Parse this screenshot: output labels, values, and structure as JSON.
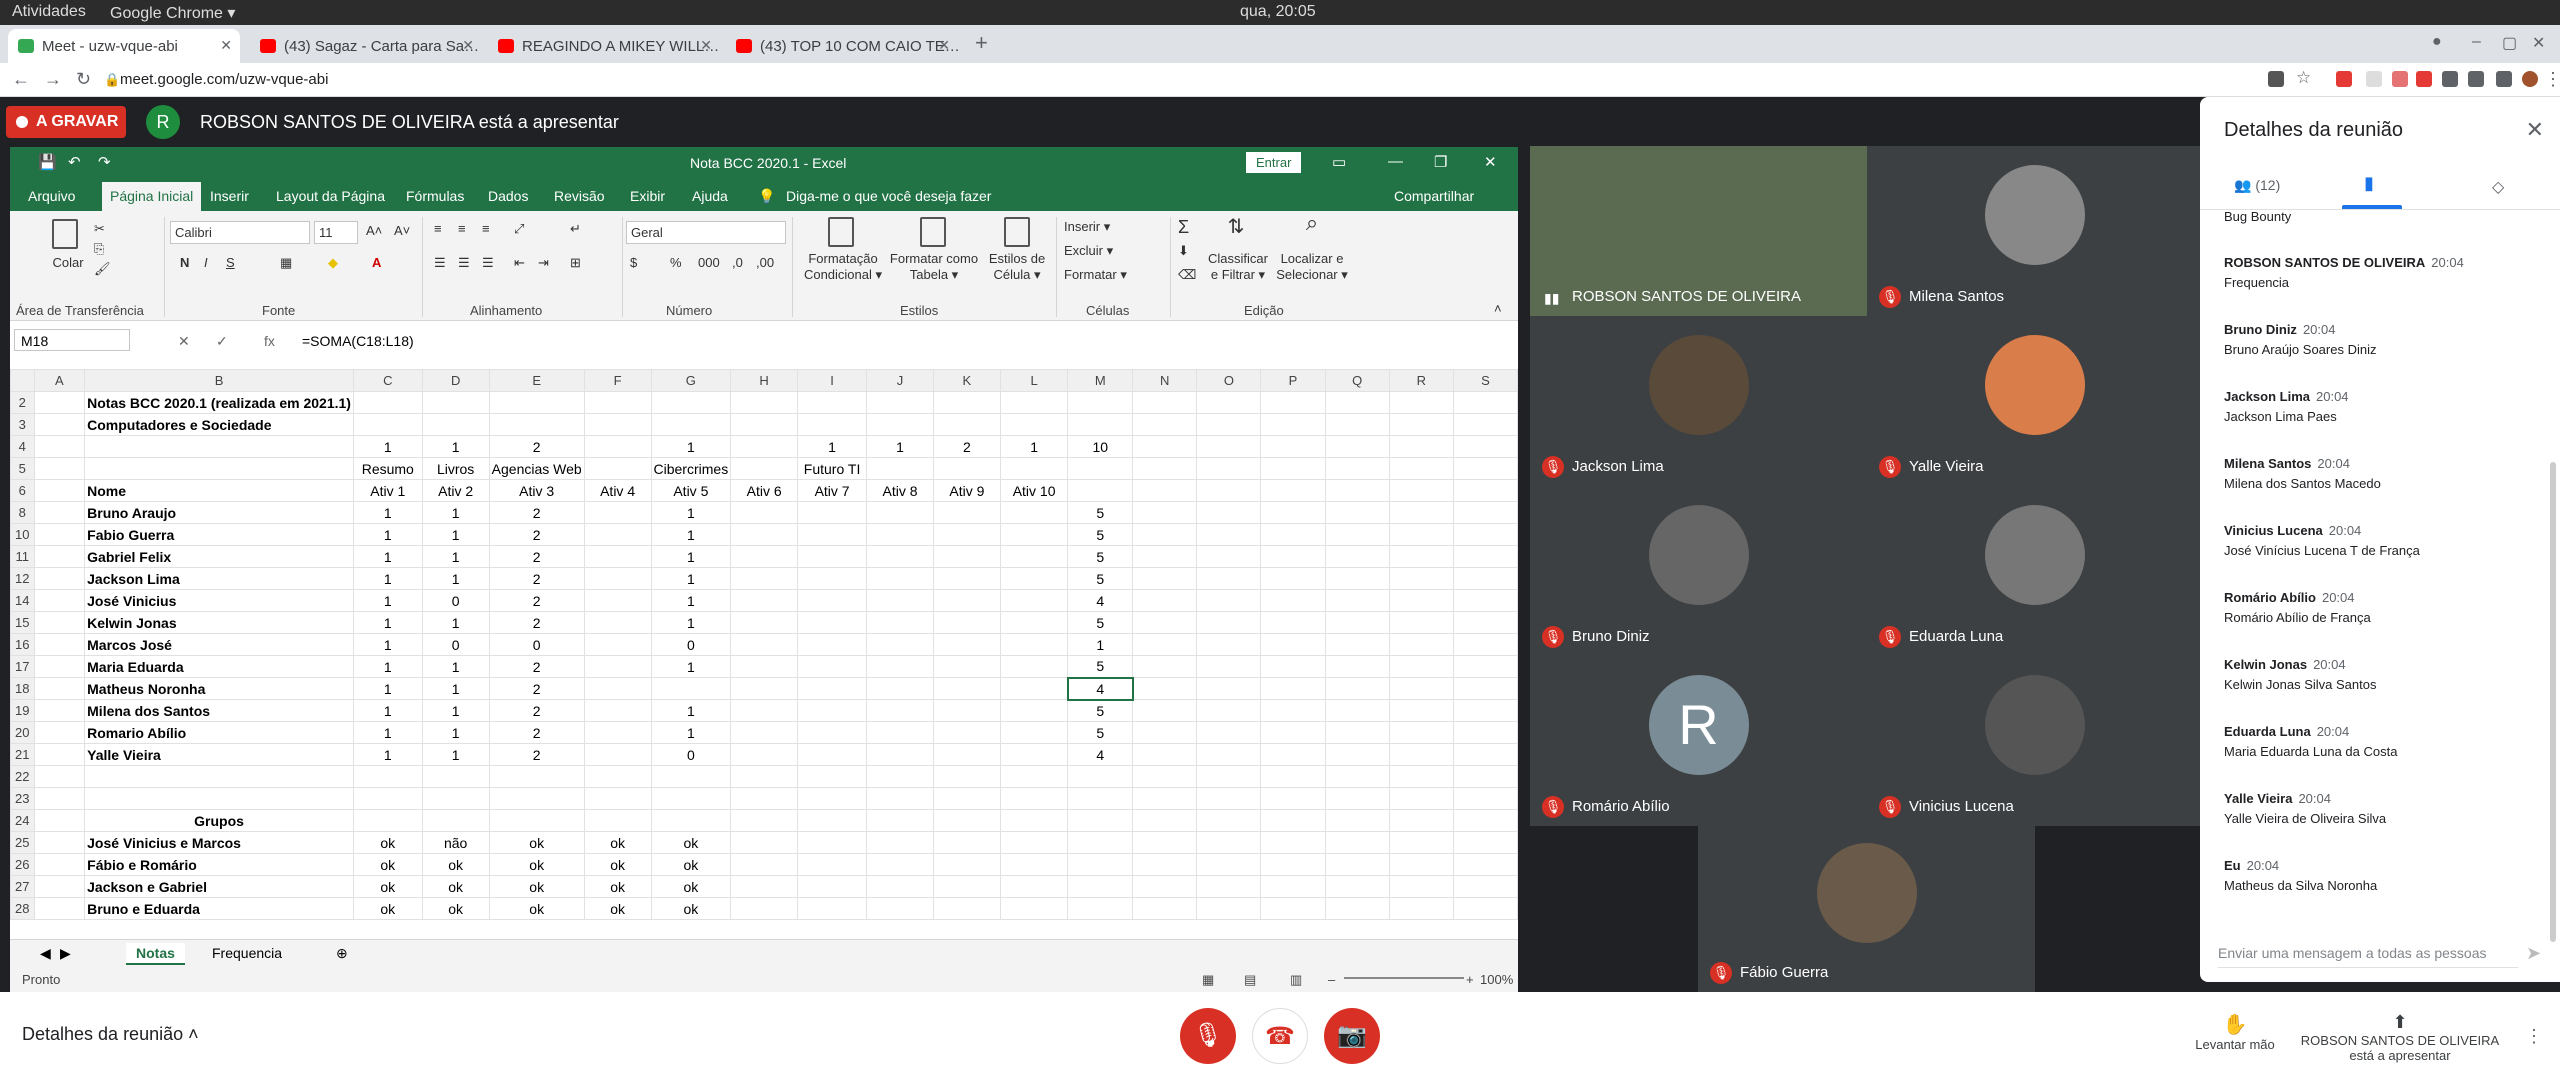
{
  "system": {
    "activities": "Atividades",
    "app": "Google Chrome ▾",
    "clock": "qua, 20:05"
  },
  "tabs": [
    {
      "title": "Meet - uzw-vque-abi",
      "color": "#34a853"
    },
    {
      "title": "(43) Sagaz - Carta para Sa…",
      "color": "#ff0000"
    },
    {
      "title": "REAGINDO A MIKEY WILL…",
      "color": "#ff0000"
    },
    {
      "title": "(43) TOP 10 COM CAIO TE…",
      "color": "#ff0000"
    }
  ],
  "address": {
    "url": "meet.google.com/uzw-vque-abi"
  },
  "meet": {
    "recording": "A GRAVAR",
    "presenter_initial": "R",
    "presenting_text": "ROBSON SANTOS DE OLIVEIRA está a apresentar"
  },
  "excel": {
    "title": "Nota BCC 2020.1  -  Excel",
    "enter": "Entrar",
    "menu": [
      "Arquivo",
      "Página Inicial",
      "Inserir",
      "Layout da Página",
      "Fórmulas",
      "Dados",
      "Revisão",
      "Exibir",
      "Ajuda",
      "Diga-me o que você deseja fazer",
      "Compartilhar"
    ],
    "ribbon": {
      "paste": "Colar",
      "font": "Calibri",
      "size": "11",
      "format": "Geral",
      "groups": [
        "Área de Transferência",
        "Fonte",
        "Alinhamento",
        "Número",
        "Estilos",
        "Células",
        "Edição"
      ],
      "styles": [
        "Formatação Condicional ▾",
        "Formatar como Tabela ▾",
        "Estilos de Célula ▾"
      ],
      "cells": [
        "Inserir ▾",
        "Excluir ▾",
        "Formatar ▾"
      ],
      "edit": [
        "Classificar e Filtrar ▾",
        "Localizar e Selecionar ▾"
      ]
    },
    "namebox": "M18",
    "fx": "fx",
    "formula": "=SOMA(C18:L18)",
    "cols": [
      "A",
      "B",
      "C",
      "D",
      "E",
      "F",
      "G",
      "H",
      "I",
      "J",
      "K",
      "L",
      "M",
      "N",
      "O",
      "P",
      "Q",
      "R",
      "S"
    ],
    "rows": [
      {
        "n": "2",
        "b": "Notas BCC 2020.1 (realizada em 2021.1)",
        "c": []
      },
      {
        "n": "3",
        "b": "Computadores e Sociedade",
        "c": []
      },
      {
        "n": "4",
        "b": "",
        "c": [
          "1",
          "1",
          "2",
          "",
          "1",
          "",
          "1",
          "1",
          "2",
          "1",
          "10"
        ]
      },
      {
        "n": "5",
        "b": "",
        "c": [
          "Resumo",
          "Livros",
          "Agencias Web",
          "",
          "Cibercrimes",
          "",
          "Futuro TI",
          "",
          "",
          "",
          ""
        ]
      },
      {
        "n": "6",
        "b": "Nome",
        "c": [
          "Ativ 1",
          "Ativ 2",
          "Ativ 3",
          "Ativ 4",
          "Ativ 5",
          "Ativ 6",
          "Ativ 7",
          "Ativ 8",
          "Ativ 9",
          "Ativ 10",
          ""
        ]
      },
      {
        "n": "8",
        "b": "Bruno Araujo",
        "c": [
          "1",
          "1",
          "2",
          "",
          "1",
          "",
          "",
          "",
          "",
          "",
          "5"
        ]
      },
      {
        "n": "10",
        "b": "Fabio Guerra",
        "c": [
          "1",
          "1",
          "2",
          "",
          "1",
          "",
          "",
          "",
          "",
          "",
          "5"
        ]
      },
      {
        "n": "11",
        "b": "Gabriel Felix",
        "c": [
          "1",
          "1",
          "2",
          "",
          "1",
          "",
          "",
          "",
          "",
          "",
          "5"
        ]
      },
      {
        "n": "12",
        "b": "Jackson Lima",
        "c": [
          "1",
          "1",
          "2",
          "",
          "1",
          "",
          "",
          "",
          "",
          "",
          "5"
        ]
      },
      {
        "n": "14",
        "b": "José Vinicius",
        "c": [
          "1",
          "0",
          "2",
          "",
          "1",
          "",
          "",
          "",
          "",
          "",
          "4"
        ]
      },
      {
        "n": "15",
        "b": "Kelwin Jonas",
        "c": [
          "1",
          "1",
          "2",
          "",
          "1",
          "",
          "",
          "",
          "",
          "",
          "5"
        ]
      },
      {
        "n": "16",
        "b": "Marcos José",
        "c": [
          "1",
          "0",
          "0",
          "",
          "0",
          "",
          "",
          "",
          "",
          "",
          "1"
        ]
      },
      {
        "n": "17",
        "b": "Maria Eduarda",
        "c": [
          "1",
          "1",
          "2",
          "",
          "1",
          "",
          "",
          "",
          "",
          "",
          "5"
        ]
      },
      {
        "n": "18",
        "b": "Matheus Noronha",
        "c": [
          "1",
          "1",
          "2",
          "",
          "",
          "",
          "",
          "",
          "",
          "",
          "4"
        ]
      },
      {
        "n": "19",
        "b": "Milena dos Santos",
        "c": [
          "1",
          "1",
          "2",
          "",
          "1",
          "",
          "",
          "",
          "",
          "",
          "5"
        ]
      },
      {
        "n": "20",
        "b": "Romario Abílio",
        "c": [
          "1",
          "1",
          "2",
          "",
          "1",
          "",
          "",
          "",
          "",
          "",
          "5"
        ]
      },
      {
        "n": "21",
        "b": "Yalle Vieira",
        "c": [
          "1",
          "1",
          "2",
          "",
          "0",
          "",
          "",
          "",
          "",
          "",
          "4"
        ]
      },
      {
        "n": "22",
        "b": "",
        "c": []
      },
      {
        "n": "23",
        "b": "",
        "c": []
      },
      {
        "n": "24",
        "b": "Grupos",
        "c": []
      },
      {
        "n": "25",
        "b": "José Vinicius e Marcos",
        "c": [
          "ok",
          "não",
          "ok",
          "ok",
          "ok"
        ]
      },
      {
        "n": "26",
        "b": "Fábio e Romário",
        "c": [
          "ok",
          "ok",
          "ok",
          "ok",
          "ok"
        ]
      },
      {
        "n": "27",
        "b": "Jackson e Gabriel",
        "c": [
          "ok",
          "ok",
          "ok",
          "ok",
          "ok"
        ]
      },
      {
        "n": "28",
        "b": "Bruno e Eduarda",
        "c": [
          "ok",
          "ok",
          "ok",
          "ok",
          "ok"
        ]
      }
    ],
    "sheets": [
      "Notas",
      "Frequencia"
    ],
    "status": "Pronto",
    "zoom": "100%"
  },
  "participants": [
    {
      "name": "ROBSON SANTOS DE OLIVEIRA",
      "muted": false
    },
    {
      "name": "Milena Santos",
      "muted": true
    },
    {
      "name": "Jackson Lima",
      "muted": true
    },
    {
      "name": "Yalle Vieira",
      "muted": true
    },
    {
      "name": "Bruno Diniz",
      "muted": true
    },
    {
      "name": "Eduarda Luna",
      "muted": true
    },
    {
      "name": "Romário Abílio",
      "muted": true,
      "initial": "R"
    },
    {
      "name": "Vinicius Lucena",
      "muted": true
    },
    {
      "name": "Fábio Guerra",
      "muted": true
    }
  ],
  "panel": {
    "title": "Detalhes da reunião",
    "people_count": "(12)",
    "top_snippet": "Bug Bounty",
    "messages": [
      {
        "who": "ROBSON SANTOS DE OLIVEIRA",
        "time": "20:04",
        "text": "Frequencia"
      },
      {
        "who": "Bruno Diniz",
        "time": "20:04",
        "text": "Bruno Araújo Soares Diniz"
      },
      {
        "who": "Jackson Lima",
        "time": "20:04",
        "text": "Jackson Lima Paes"
      },
      {
        "who": "Milena Santos",
        "time": "20:04",
        "text": "Milena dos Santos Macedo"
      },
      {
        "who": "Vinicius Lucena",
        "time": "20:04",
        "text": "José Vinícius Lucena T de França"
      },
      {
        "who": "Romário Abílio",
        "time": "20:04",
        "text": "Romário Abílio de França"
      },
      {
        "who": "Kelwin Jonas",
        "time": "20:04",
        "text": "Kelwin Jonas Silva Santos"
      },
      {
        "who": "Eduarda Luna",
        "time": "20:04",
        "text": "Maria Eduarda Luna da Costa"
      },
      {
        "who": "Yalle Vieira",
        "time": "20:04",
        "text": "Yalle Vieira de Oliveira Silva"
      },
      {
        "who": "Eu",
        "time": "20:04",
        "text": "Matheus da Silva Noronha"
      }
    ],
    "input_placeholder": "Enviar uma mensagem a todas as pessoas"
  },
  "bottom": {
    "details": "Detalhes da reunião",
    "raise_hand": "Levantar mão",
    "presenting_name": "ROBSON SANTOS DE OLIVEIRA",
    "presenting_sub": "está a apresentar"
  }
}
